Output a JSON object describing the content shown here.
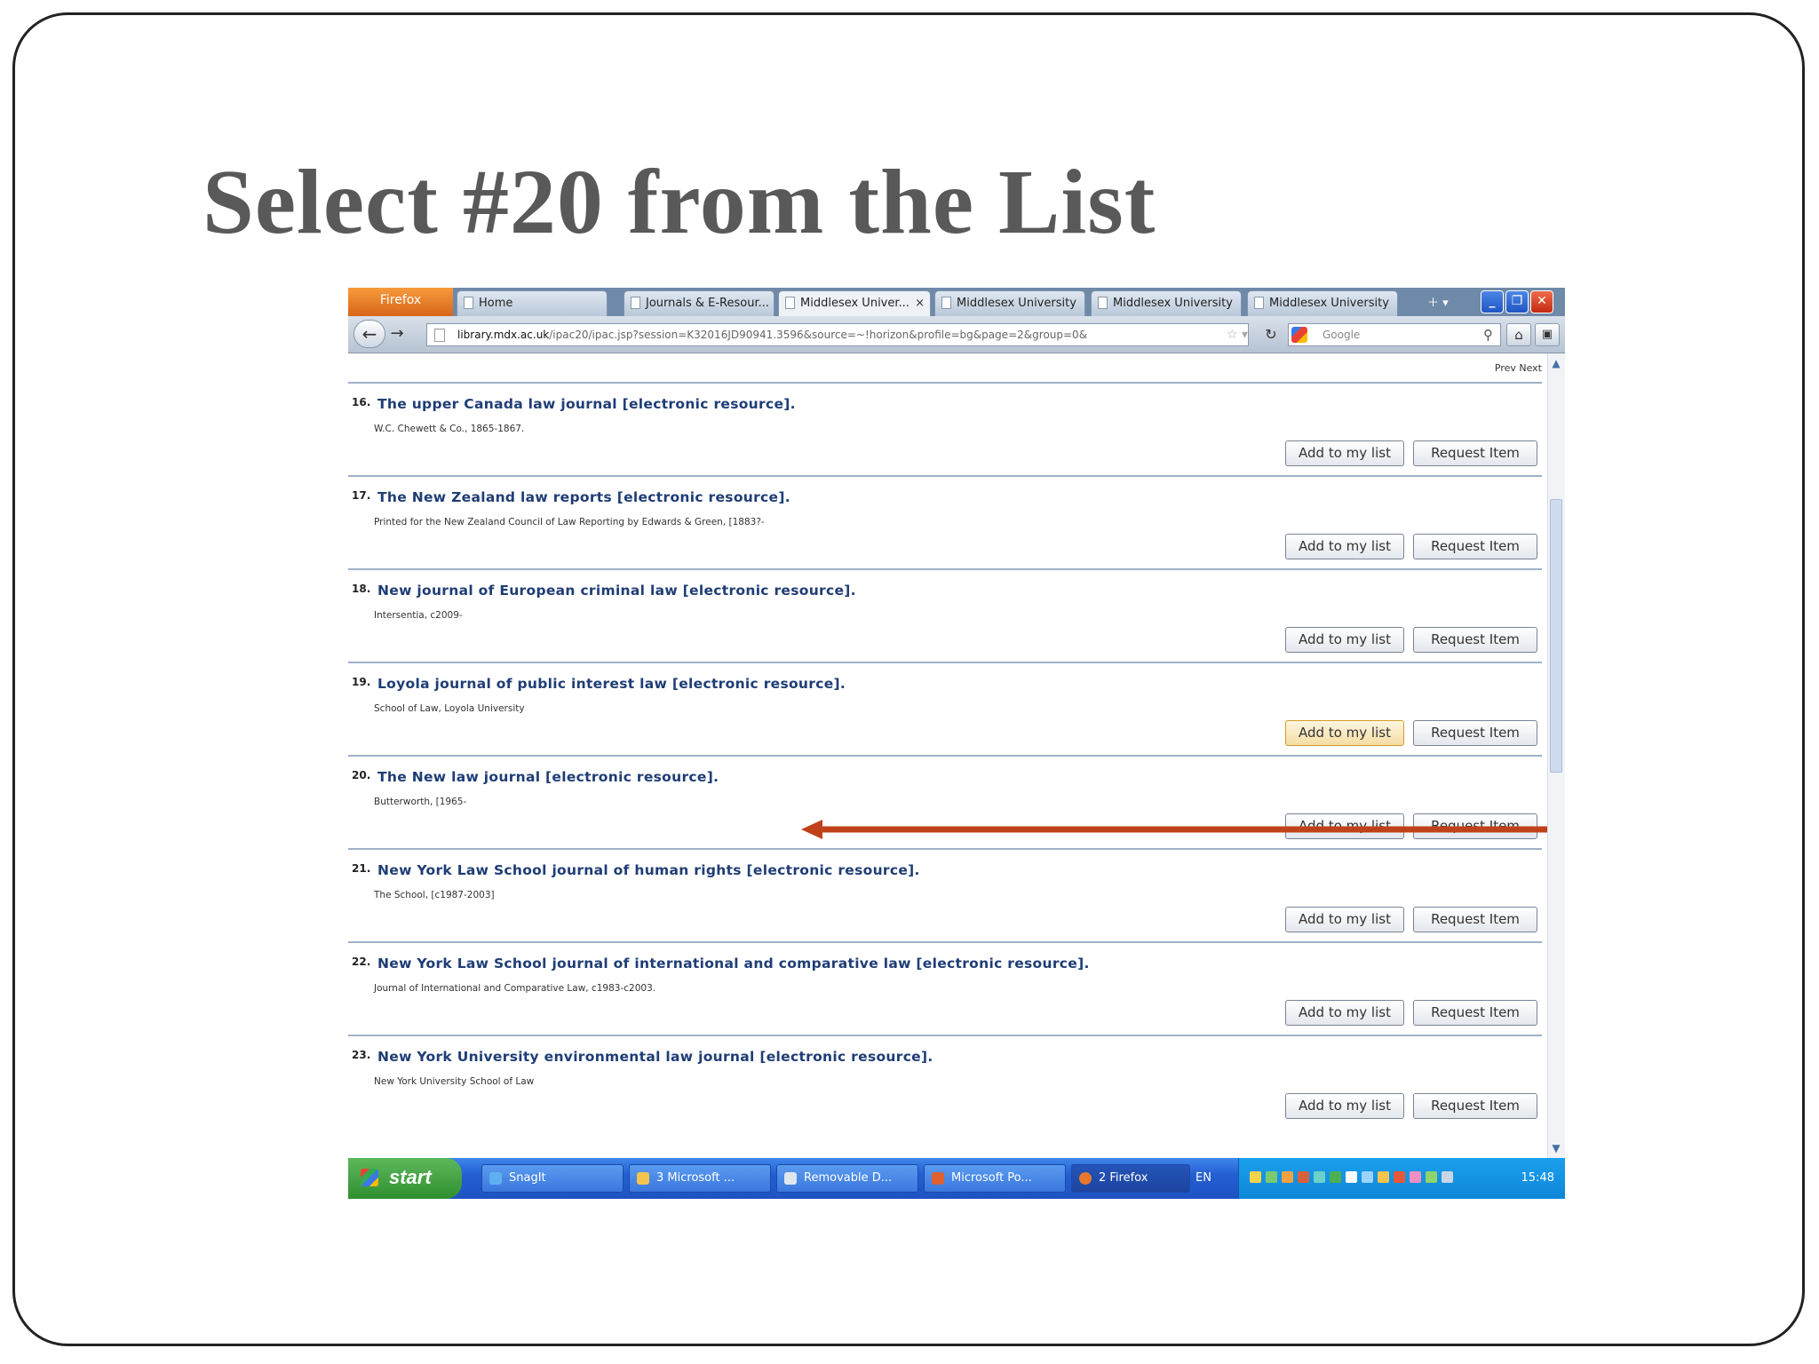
{
  "slide": {
    "title": "Select #20 from the List"
  },
  "browser": {
    "menu_button": "Firefox",
    "tabs": [
      {
        "label": "Home"
      },
      {
        "label": "Journals & E-Resour..."
      },
      {
        "label": "Middlesex Univer...",
        "close": "×"
      },
      {
        "label": "Middlesex University"
      },
      {
        "label": "Middlesex University"
      },
      {
        "label": "Middlesex University"
      }
    ],
    "url": {
      "domain": "library.mdx.ac.uk",
      "path": "/ipac20/ipac.jsp?session=K32016JD90941.3596&source=~!horizon&profile=bg&page=2&group=0&"
    },
    "search_placeholder": "Google",
    "prev_next": "Prev  Next"
  },
  "results": [
    {
      "num": "16.",
      "title": "The upper Canada law journal [electronic resource].",
      "pub": "W.C. Chewett & Co., 1865-1867."
    },
    {
      "num": "17.",
      "title": "The New Zealand law reports [electronic resource].",
      "pub": "Printed for the New Zealand Council of Law Reporting by Edwards & Green, [1883?-"
    },
    {
      "num": "18.",
      "title": "New journal of European criminal law [electronic resource].",
      "pub": "Intersentia, c2009-"
    },
    {
      "num": "19.",
      "title": "Loyola journal of public interest law [electronic resource].",
      "pub": "School of Law, Loyola University"
    },
    {
      "num": "20.",
      "title": "The New law journal [electronic resource].",
      "pub": "Butterworth, [1965-"
    },
    {
      "num": "21.",
      "title": "New York Law School journal of human rights [electronic resource].",
      "pub": "The School, [c1987-2003]"
    },
    {
      "num": "22.",
      "title": "New York Law School journal of international and comparative law [electronic resource].",
      "pub": "Journal of International and Comparative Law, c1983-c2003."
    },
    {
      "num": "23.",
      "title": "New York University environmental law journal [electronic resource].",
      "pub": "New York University School of Law"
    }
  ],
  "buttons": {
    "add": "Add to my list",
    "request": "Request Item"
  },
  "taskbar": {
    "start": "start",
    "items": [
      {
        "label": "SnagIt"
      },
      {
        "label": "3 Microsoft ..."
      },
      {
        "label": "Removable D..."
      },
      {
        "label": "Microsoft Po..."
      },
      {
        "label": "2 Firefox"
      }
    ],
    "language": "EN",
    "clock": "15:48"
  },
  "colors": {
    "arrow": "#c0421a",
    "link": "#1f3d75"
  }
}
